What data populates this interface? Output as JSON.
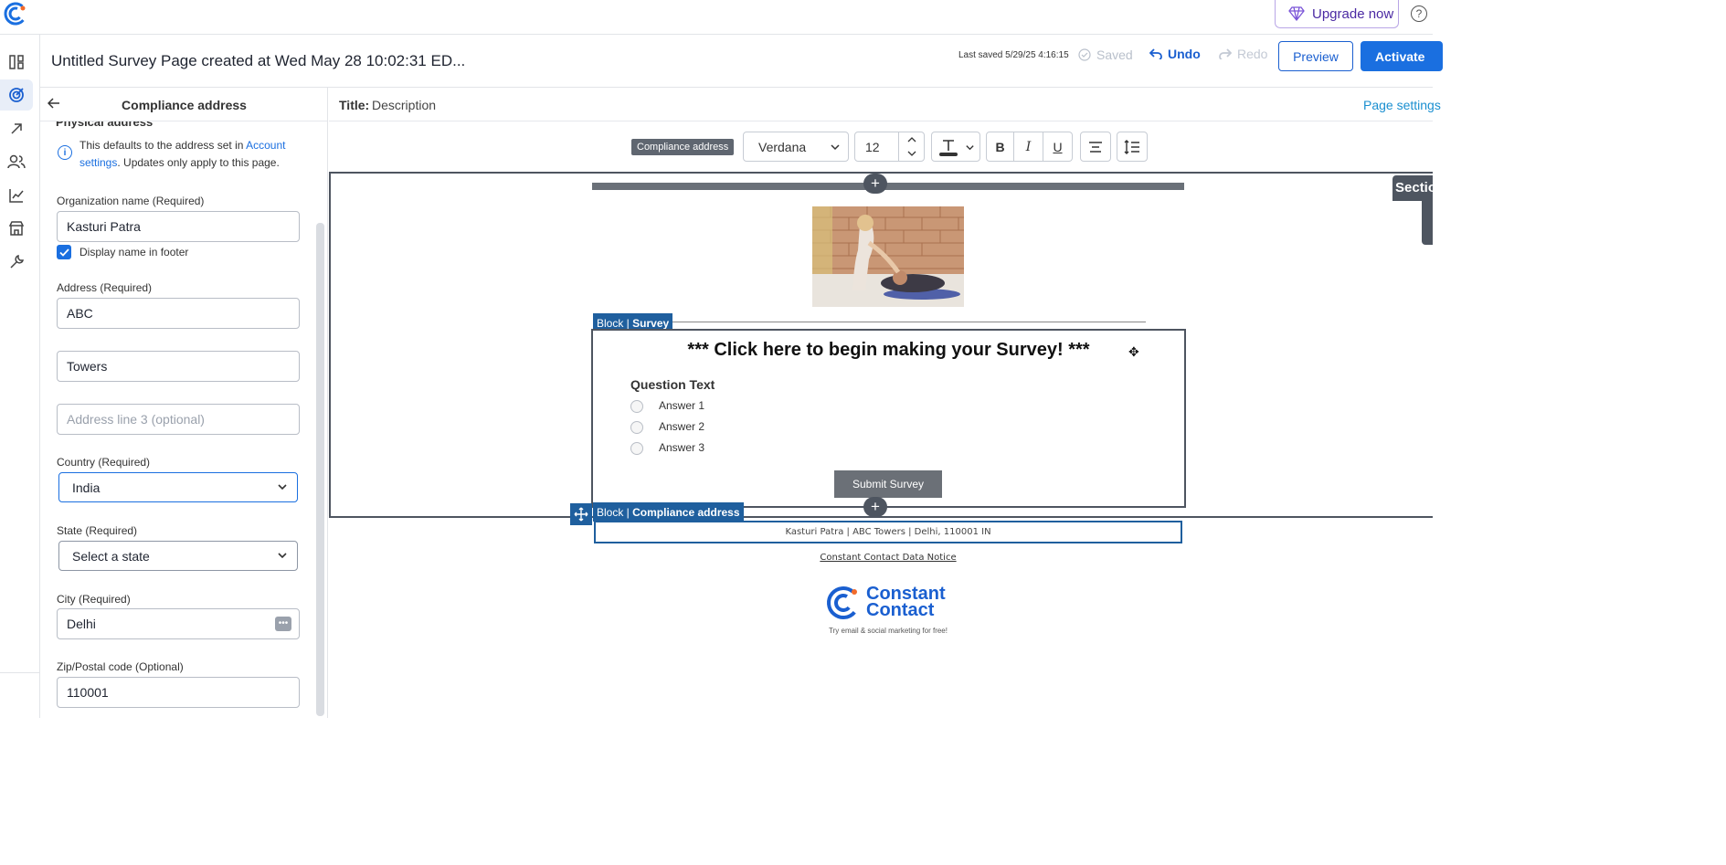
{
  "topbar": {
    "upgrade_label": "Upgrade now",
    "help_label": "?"
  },
  "rail": {
    "items": [
      "dashboard",
      "campaigns",
      "reports-arrow",
      "contacts",
      "analytics",
      "store",
      "tools"
    ]
  },
  "header": {
    "title": "Untitled Survey Page created at Wed May 28 10:02:31 ED...",
    "last_saved": "Last saved 5/29/25 4:16:15",
    "saved_label": "Saved",
    "undo_label": "Undo",
    "redo_label": "Redo",
    "preview_label": "Preview",
    "activate_label": "Activate"
  },
  "panel": {
    "title": "Compliance address",
    "section_cut": "Physical address",
    "info_prefix": "This defaults to the address set in ",
    "info_link": "Account settings",
    "info_suffix": ". Updates only apply to this page.",
    "org_label": "Organization name  (Required)",
    "org_value": "Kasturi Patra",
    "display_name_label": "Display name in footer",
    "display_name_checked": true,
    "address_label": "Address  (Required)",
    "address1": "ABC",
    "address2": "Towers",
    "address3_placeholder": "Address line 3 (optional)",
    "country_label": "Country  (Required)",
    "country_value": "India",
    "state_label": "State  (Required)",
    "state_value": "Select a state",
    "city_label": "City  (Required)",
    "city_value": "Delhi",
    "zip_label": "Zip/Postal code  (Optional)",
    "zip_value": "110001"
  },
  "editor": {
    "title_label": "Title:",
    "title_value": "Description",
    "page_settings": "Page settings",
    "toolbar": {
      "block_tag": "Compliance address",
      "font": "Verdana",
      "size": "12",
      "bold": "B",
      "italic": "I",
      "underline": "U"
    },
    "section_tab": "Section",
    "survey_block_prefix": "Block | ",
    "survey_block_name": "Survey",
    "survey_heading": "*** Click here to begin making your Survey! ***",
    "question": "Question Text",
    "answers": [
      "Answer 1",
      "Answer 2",
      "Answer 3"
    ],
    "submit": "Submit Survey",
    "compliance_block_prefix": "Block | ",
    "compliance_block_name": "Compliance address",
    "footer_address": "Kasturi Patra | ABC Towers | Delhi, 110001 IN",
    "data_notice": "Constant Contact Data Notice",
    "cc_name": "Constant Contact",
    "cc_tagline": "Try email & social marketing for free!"
  },
  "colors": {
    "brand_blue": "#1a6fe0",
    "block_blue": "#1f5f9e",
    "upgrade_purple": "#4b2aa3"
  }
}
